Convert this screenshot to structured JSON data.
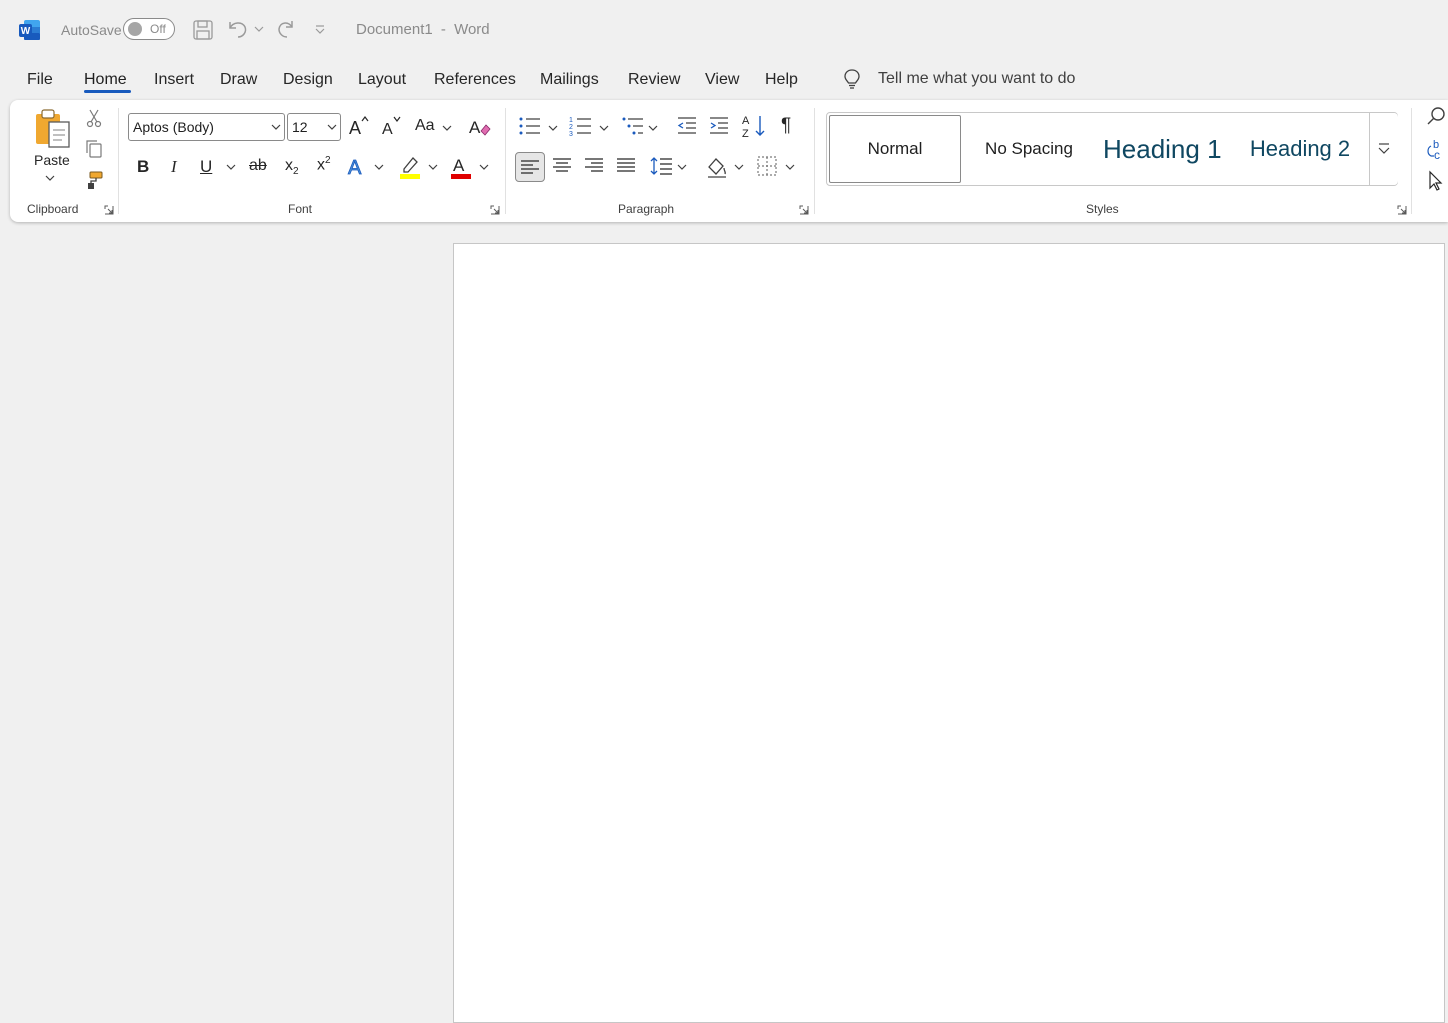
{
  "titlebar": {
    "autosave_label": "AutoSave",
    "autosave_state": "Off",
    "document_title": "Document1",
    "separator": "-",
    "app_name": "Word"
  },
  "tabs": [
    {
      "label": "File"
    },
    {
      "label": "Home",
      "active": true
    },
    {
      "label": "Insert"
    },
    {
      "label": "Draw"
    },
    {
      "label": "Design"
    },
    {
      "label": "Layout"
    },
    {
      "label": "References"
    },
    {
      "label": "Mailings"
    },
    {
      "label": "Review"
    },
    {
      "label": "View"
    },
    {
      "label": "Help"
    }
  ],
  "tell_me": {
    "placeholder": "Tell me what you want to do"
  },
  "clipboard": {
    "paste_label": "Paste",
    "group_label": "Clipboard"
  },
  "font": {
    "family": "Aptos (Body)",
    "size": "12",
    "case_label": "Aa",
    "group_label": "Font",
    "highlight_color": "#ffff00",
    "font_color": "#e00000"
  },
  "paragraph": {
    "group_label": "Paragraph"
  },
  "styles": {
    "group_label": "Styles",
    "items": [
      {
        "label": "Normal"
      },
      {
        "label": "No Spacing"
      },
      {
        "label": "Heading 1"
      },
      {
        "label": "Heading 2"
      }
    ]
  },
  "colors": {
    "accent": "#185abd",
    "heading": "#0f4761"
  }
}
